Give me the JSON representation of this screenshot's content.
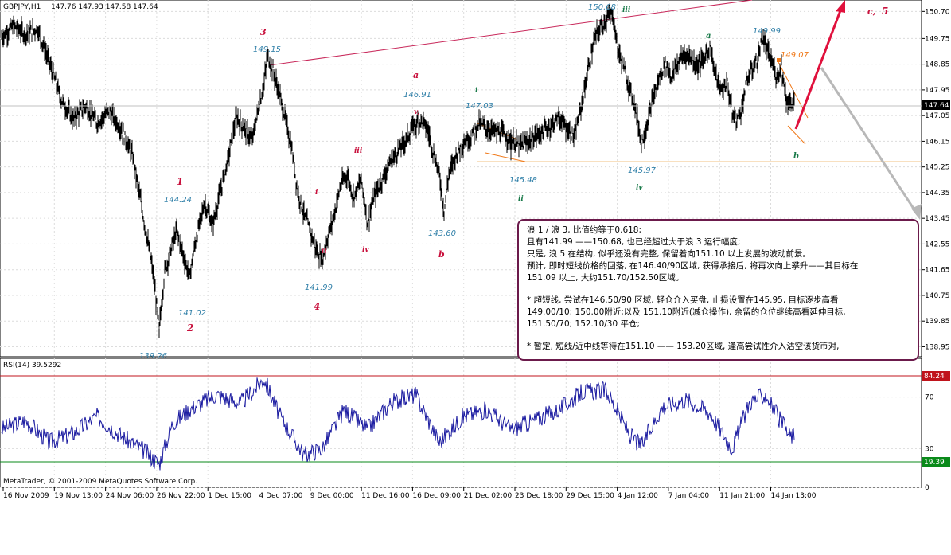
{
  "header": {
    "symbol": "GBPJPY,H1",
    "ohlc": "147.76 147.93 147.58 147.64"
  },
  "rsi_header": "RSI(14) 39.5292",
  "copyright": "MetaTrader, © 2001-2009 MetaQuotes Software Corp.",
  "current_price": "147.64",
  "rsi_levels": {
    "upper": "84.24",
    "lower": "19.39"
  },
  "colors": {
    "candle": "#000000",
    "rsi_line": "#1a1aa0",
    "trendline": "#c8285a",
    "projection": "#e0103c",
    "wave_red": "#c8103c",
    "wave_green": "#1a7a4a",
    "price_label": "#2f7fa8",
    "channel": "#f07818",
    "note_border": "#6b1a4b"
  },
  "annotations": {
    "wave_labels": [
      "1",
      "2",
      "3",
      "4",
      "a",
      "b",
      "i",
      "ii",
      "iii",
      "iv",
      "v,",
      "i",
      "ii",
      "iii",
      "iv",
      "a",
      "b",
      "c,",
      "5",
      "i",
      "ii"
    ],
    "price_labels": [
      "150.68",
      "149.15",
      "146.91",
      "147.03",
      "144.24",
      "141.02",
      "139.26",
      "141.99",
      "143.60",
      "145.48",
      "145.97",
      "149.99",
      "149.07"
    ]
  },
  "note": {
    "lines": [
      "浪 1 / 浪 3, 比值约等于0.618;",
      "且有141.99 ——150.68, 也已经超过大于浪 3 运行幅度;",
      "只是, 浪 5 在结构, 似乎还没有完整, 保留着向151.10 以上发展的波动前景。",
      "预计, 即时短线价格的回落, 在146.40/90区域, 获得承接后, 将再次向上攀升——其目标在",
      "151.09 以上, 大约151.70/152.50区域。",
      "",
      "* 超短线, 尝试在146.50/90 区域, 轻仓介入买盘, 止损设置在145.95, 目标逐步高看",
      "149.00/10; 150.00附近;以及 151.10附近(减仓操作), 余留的仓位继续高看延伸目标,",
      "151.50/70; 152.10/30 平仓;",
      "",
      "* 暂定, 短线/近中线等待在151.10 —— 153.20区域, 逢高尝试性介入沽空该货币对,"
    ]
  },
  "chart_data": [
    {
      "type": "candlestick",
      "title": "GBPJPY,H1",
      "ylim": [
        138.6,
        151.1
      ],
      "y_ticks": [
        150.7,
        149.75,
        148.85,
        147.95,
        147.05,
        146.15,
        145.25,
        144.35,
        143.45,
        142.55,
        141.65,
        140.75,
        139.85,
        138.95
      ],
      "x_ticks": [
        "16 Nov 2009",
        "19 Nov 13:00",
        "24 Nov 06:00",
        "26 Nov 22:00",
        "1 Dec 15:00",
        "4 Dec 07:00",
        "9 Dec 00:00",
        "11 Dec 16:00",
        "16 Dec 09:00",
        "21 Dec 02:00",
        "23 Dec 18:00",
        "29 Dec 15:00",
        "4 Jan 12:00",
        "7 Jan 04:00",
        "11 Jan 21:00",
        "14 Jan 13:00"
      ],
      "close_path": [
        [
          0,
          149.8
        ],
        [
          15,
          150.2
        ],
        [
          30,
          149.9
        ],
        [
          45,
          150.1
        ],
        [
          60,
          148.9
        ],
        [
          75,
          147.6
        ],
        [
          90,
          146.9
        ],
        [
          105,
          147.4
        ],
        [
          120,
          146.8
        ],
        [
          135,
          147.2
        ],
        [
          150,
          146.6
        ],
        [
          165,
          145.6
        ],
        [
          180,
          143.2
        ],
        [
          190,
          141.6
        ],
        [
          198,
          139.6
        ],
        [
          205,
          141.6
        ],
        [
          212,
          142.3
        ],
        [
          220,
          143.0
        ],
        [
          228,
          142.2
        ],
        [
          236,
          141.4
        ],
        [
          245,
          142.8
        ],
        [
          255,
          144.0
        ],
        [
          265,
          143.2
        ],
        [
          275,
          144.4
        ],
        [
          285,
          145.6
        ],
        [
          295,
          147.0
        ],
        [
          305,
          146.6
        ],
        [
          315,
          146.2
        ],
        [
          322,
          147.2
        ],
        [
          330,
          148.2
        ],
        [
          334,
          149.15
        ],
        [
          340,
          148.7
        ],
        [
          348,
          147.9
        ],
        [
          356,
          147.0
        ],
        [
          364,
          146.0
        ],
        [
          372,
          144.4
        ],
        [
          380,
          143.6
        ],
        [
          388,
          143.0
        ],
        [
          396,
          142.3
        ],
        [
          403,
          142.0
        ],
        [
          410,
          142.8
        ],
        [
          418,
          143.6
        ],
        [
          426,
          144.6
        ],
        [
          434,
          145.0
        ],
        [
          442,
          144.2
        ],
        [
          452,
          144.8
        ],
        [
          460,
          143.3
        ],
        [
          468,
          144.2
        ],
        [
          478,
          144.8
        ],
        [
          488,
          145.4
        ],
        [
          498,
          145.8
        ],
        [
          508,
          146.2
        ],
        [
          518,
          146.7
        ],
        [
          528,
          146.9
        ],
        [
          536,
          146.5
        ],
        [
          544,
          145.6
        ],
        [
          550,
          145.0
        ],
        [
          556,
          143.7
        ],
        [
          562,
          145.0
        ],
        [
          570,
          145.6
        ],
        [
          580,
          146.1
        ],
        [
          590,
          146.3
        ],
        [
          600,
          146.8
        ],
        [
          610,
          146.6
        ],
        [
          620,
          146.5
        ],
        [
          630,
          146.4
        ],
        [
          640,
          146.2
        ],
        [
          650,
          146.0
        ],
        [
          660,
          146.1
        ],
        [
          670,
          146.3
        ],
        [
          680,
          146.5
        ],
        [
          690,
          146.7
        ],
        [
          700,
          147.0
        ],
        [
          710,
          146.6
        ],
        [
          720,
          146.3
        ],
        [
          730,
          147.6
        ],
        [
          738,
          148.8
        ],
        [
          746,
          149.8
        ],
        [
          754,
          150.2
        ],
        [
          762,
          150.5
        ],
        [
          768,
          150.6
        ],
        [
          774,
          149.4
        ],
        [
          780,
          148.9
        ],
        [
          788,
          148.1
        ],
        [
          796,
          147.4
        ],
        [
          804,
          146.1
        ],
        [
          810,
          146.6
        ],
        [
          818,
          147.6
        ],
        [
          826,
          148.3
        ],
        [
          834,
          148.9
        ],
        [
          842,
          148.4
        ],
        [
          850,
          148.9
        ],
        [
          858,
          149.2
        ],
        [
          866,
          149.1
        ],
        [
          874,
          148.8
        ],
        [
          882,
          149.0
        ],
        [
          890,
          149.5
        ],
        [
          896,
          148.6
        ],
        [
          904,
          147.9
        ],
        [
          912,
          148.2
        ],
        [
          918,
          147.1
        ],
        [
          924,
          146.9
        ],
        [
          930,
          147.3
        ],
        [
          936,
          148.2
        ],
        [
          942,
          148.6
        ],
        [
          950,
          149.0
        ],
        [
          956,
          149.8
        ],
        [
          962,
          149.3
        ],
        [
          968,
          148.9
        ],
        [
          974,
          148.4
        ],
        [
          980,
          148.8
        ],
        [
          986,
          147.6
        ],
        [
          992,
          147.4
        ],
        [
          996,
          147.64
        ]
      ],
      "low_pivots": [
        [
          198,
          139.26
        ],
        [
          403,
          141.99
        ],
        [
          556,
          143.6
        ],
        [
          804,
          145.97
        ],
        [
          640,
          145.48
        ]
      ]
    },
    {
      "type": "line",
      "title": "RSI(14) 39.5292",
      "ylim": [
        0,
        100
      ],
      "y_ticks": [
        0,
        30,
        70
      ],
      "levels": [
        84.24,
        19.39
      ],
      "values": [
        [
          0,
          45
        ],
        [
          30,
          52
        ],
        [
          60,
          35
        ],
        [
          90,
          42
        ],
        [
          120,
          55
        ],
        [
          150,
          40
        ],
        [
          180,
          28
        ],
        [
          198,
          18
        ],
        [
          215,
          50
        ],
        [
          240,
          62
        ],
        [
          270,
          72
        ],
        [
          300,
          65
        ],
        [
          330,
          84
        ],
        [
          350,
          55
        ],
        [
          380,
          25
        ],
        [
          403,
          30
        ],
        [
          430,
          60
        ],
        [
          460,
          45
        ],
        [
          490,
          66
        ],
        [
          520,
          72
        ],
        [
          550,
          35
        ],
        [
          580,
          55
        ],
        [
          610,
          60
        ],
        [
          640,
          45
        ],
        [
          670,
          52
        ],
        [
          700,
          60
        ],
        [
          730,
          74
        ],
        [
          760,
          75
        ],
        [
          790,
          40
        ],
        [
          804,
          32
        ],
        [
          830,
          62
        ],
        [
          860,
          68
        ],
        [
          890,
          58
        ],
        [
          918,
          30
        ],
        [
          940,
          66
        ],
        [
          960,
          72
        ],
        [
          975,
          55
        ],
        [
          990,
          40
        ],
        [
          996,
          39.5
        ]
      ]
    }
  ]
}
